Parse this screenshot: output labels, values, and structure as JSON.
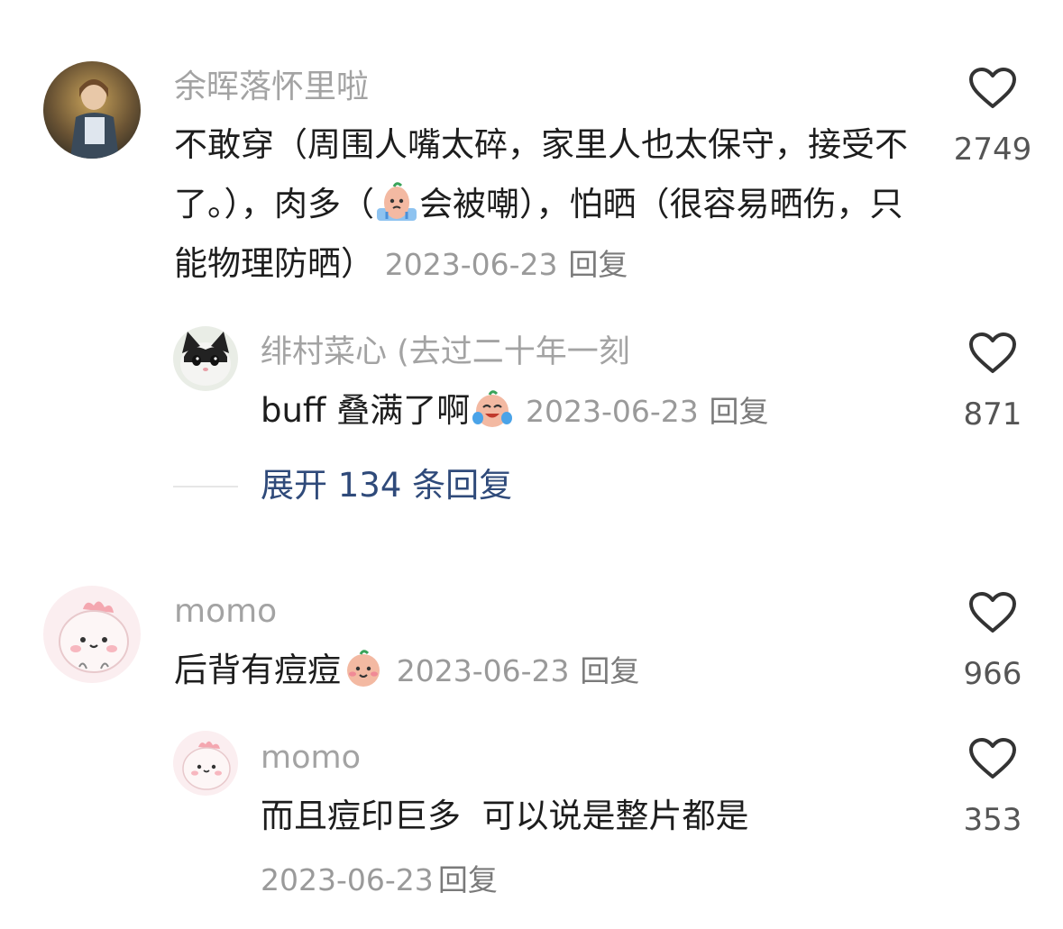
{
  "comments": [
    {
      "username": "余晖落怀里啦",
      "text_1": "不敢穿（周围人嘴太碎，家里人也太保守，接受不了。），肉多（",
      "text_2": "会被嘲），怕晒（很容易晒伤，只能物理防晒）",
      "date": "2023-06-23",
      "reply_label": "回复",
      "likes": "2749",
      "emoji": "crying-bean-emoji",
      "replies": [
        {
          "username": "绯村菜心 (去过二十年一刻",
          "text": "buff 叠满了啊",
          "emoji": "laughing-tears-emoji",
          "date": "2023-06-23",
          "reply_label": "回复",
          "likes": "871"
        }
      ],
      "expand_label": "展开 134 条回复"
    },
    {
      "username": "momo",
      "text": "后背有痘痘",
      "emoji": "blushing-bean-emoji",
      "date": "2023-06-23",
      "reply_label": "回复",
      "likes": "966",
      "replies": [
        {
          "username": "momo",
          "text": "而且痘印巨多  可以说是整片都是",
          "date": "2023-06-23",
          "reply_label": "回复",
          "likes": "353"
        }
      ]
    }
  ],
  "colors": {
    "username": "#a3a3a3",
    "meta": "#9a9a9a",
    "link": "#2f4a7a",
    "like_outline": "#333333"
  },
  "icons": {
    "like": "heart-outline-icon"
  }
}
